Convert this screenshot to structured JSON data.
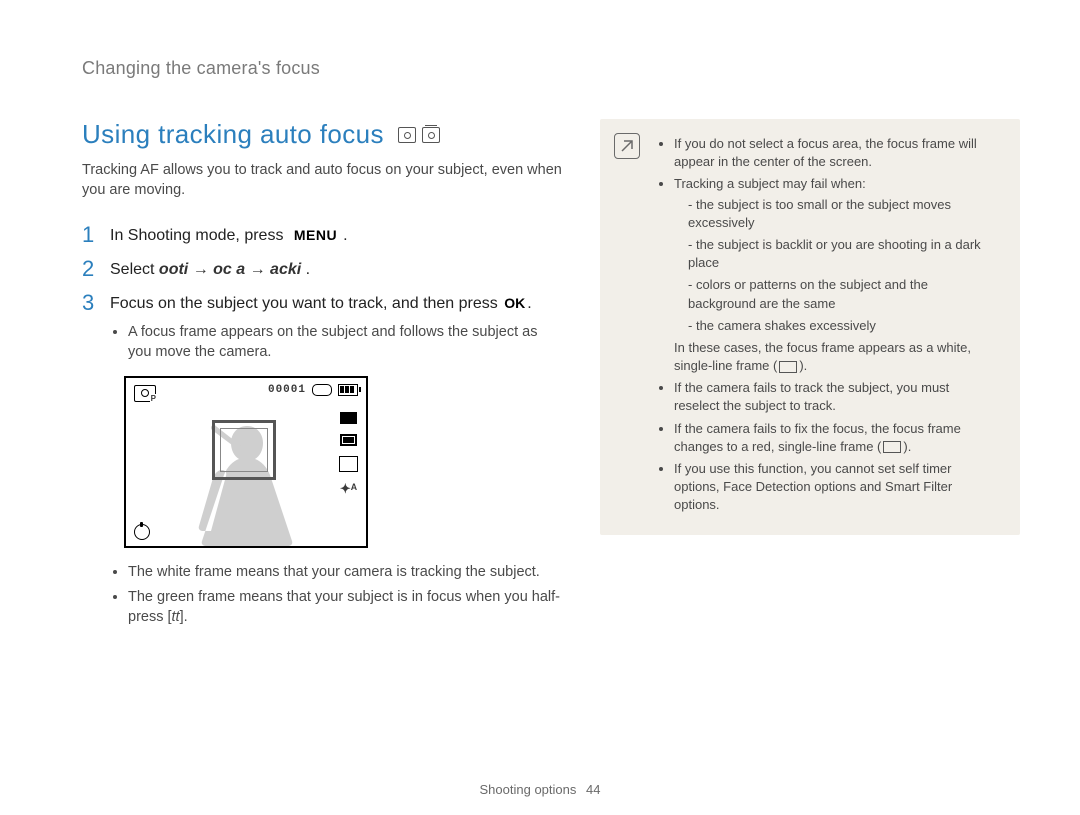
{
  "breadcrumb": "Changing the camera's focus",
  "section": {
    "title": "Using tracking auto focus",
    "intro": "Tracking AF allows you to track and auto focus on your subject, even when you are moving."
  },
  "steps": [
    {
      "num": "1",
      "pre": "In Shooting mode, press ",
      "key": "MENU",
      "post": "."
    },
    {
      "num": "2",
      "pre": "Select ",
      "italic": "ooti → oc a → acki",
      "post": " ."
    },
    {
      "num": "3",
      "pre": "Focus on the subject you want to track, and then press ",
      "key": "OK",
      "post": "."
    }
  ],
  "step3_bullets": [
    "A focus frame appears on the subject and follows the subject as you move the camera."
  ],
  "lcd": {
    "counter": "00001"
  },
  "after_lcd_bullets": [
    "The white frame means that your camera is tracking the subject.",
    "The green frame means that your subject is in focus when you half-press [tt]."
  ],
  "note": {
    "items": [
      {
        "text": "If you do not select a focus area, the focus frame will appear in the center of the screen."
      },
      {
        "text": "Tracking a subject may fail when:",
        "sub": [
          "the subject is too small or the subject moves excessively",
          "the subject is backlit or you are shooting in a dark place",
          "colors or patterns on the subject and the background are the same",
          "the camera shakes excessively"
        ],
        "after": "In these cases, the focus frame appears as a white, single-line frame ("
      },
      {
        "text": "If the camera fails to track the subject, you must reselect the subject to track."
      },
      {
        "text_pre": "If the camera fails to fix the focus, the focus frame changes to a red, single-line frame (",
        "text_post": ")."
      },
      {
        "text": "If you use this function, you cannot set self timer options, Face Detection options and Smart Filter options."
      }
    ],
    "after_suffix": ")."
  },
  "footer": {
    "label": "Shooting options",
    "page": "44"
  }
}
